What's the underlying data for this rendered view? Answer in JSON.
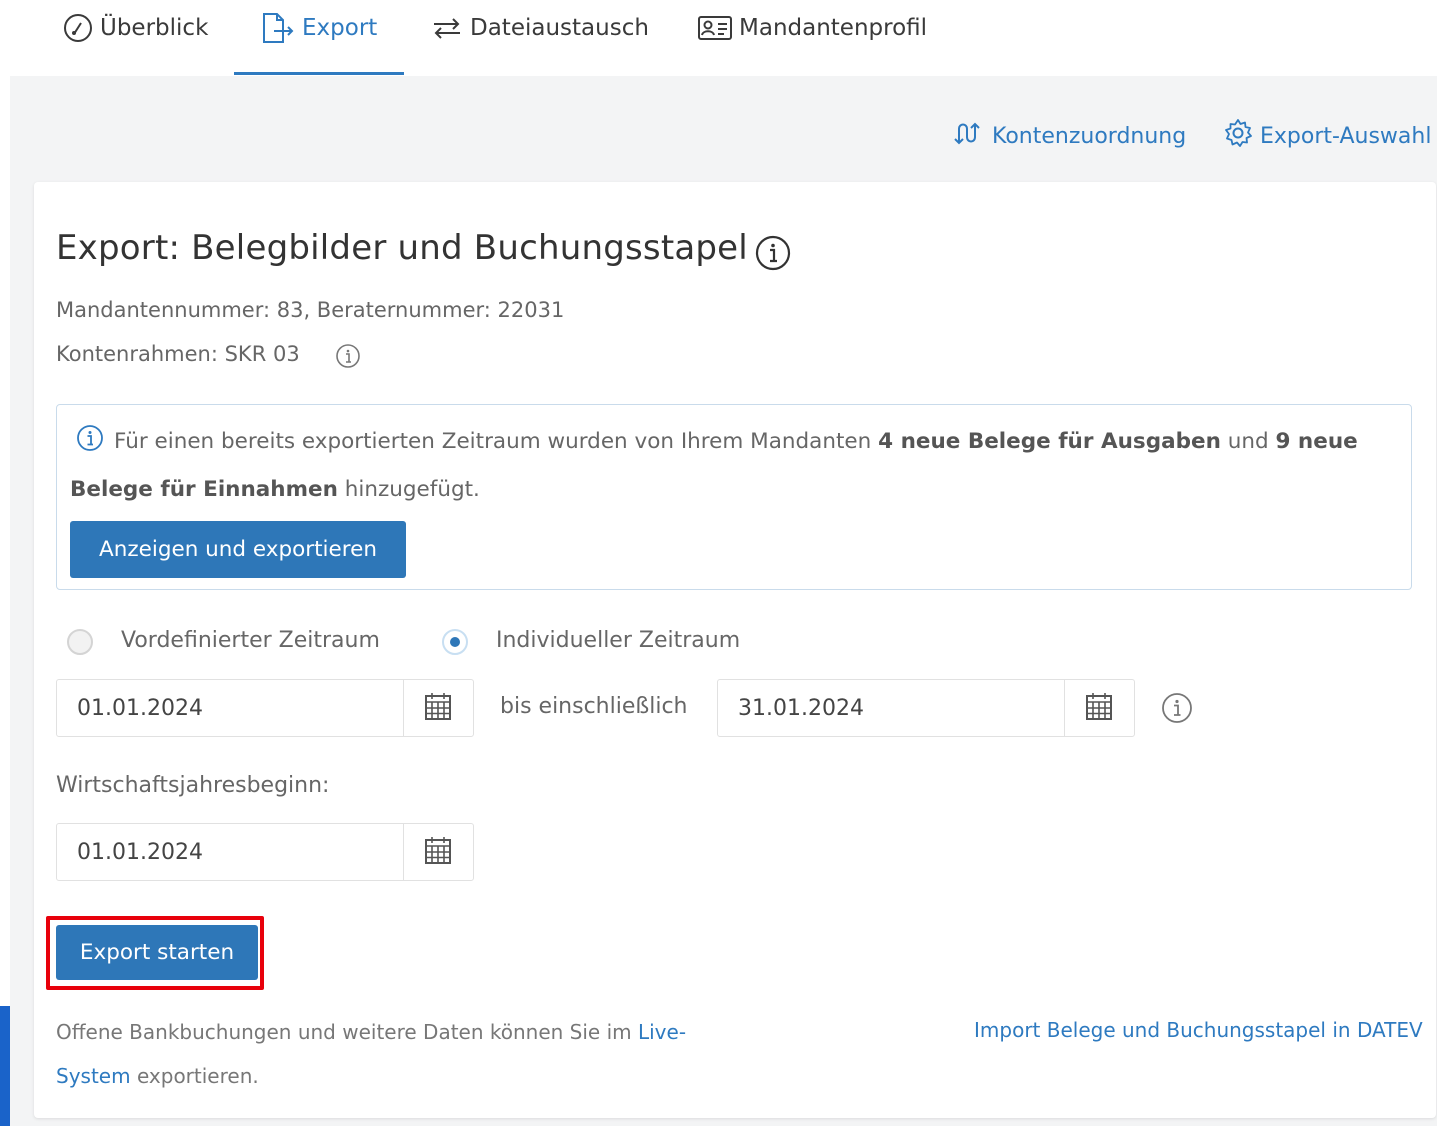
{
  "tabs": [
    {
      "label": "Überblick",
      "icon": "dial-icon",
      "active": false
    },
    {
      "label": "Export",
      "icon": "file-export-icon",
      "active": true
    },
    {
      "label": "Dateiaustausch",
      "icon": "swap-arrows-icon",
      "active": false
    },
    {
      "label": "Mandantenprofil",
      "icon": "id-card-icon",
      "active": false
    }
  ],
  "toolbar": {
    "kontenzuordnung": "Kontenzuordnung",
    "export_auswahl": "Export-Auswahl"
  },
  "card": {
    "title": "Export: Belegbilder und Buchungsstapel",
    "meta_numbers": "Mandantennummer: 83, Beraternummer: 22031",
    "meta_kontenrahmen": "Kontenrahmen: SKR 03"
  },
  "notice": {
    "text_1": "Für einen bereits exportierten Zeitraum wurden von Ihrem Mandanten",
    "bold_1": "4 neue Belege für Ausgaben",
    "text_2": "und",
    "bold_2": "9 neue Belege für Einnahmen",
    "text_3": "hinzugefügt.",
    "button": "Anzeigen und exportieren"
  },
  "period": {
    "option_predefined": "Vordefinierter Zeitraum",
    "option_individual": "Individueller Zeitraum",
    "selected": "individual",
    "from": "01.01.2024",
    "separator": "bis einschließlich",
    "to": "31.01.2024"
  },
  "fiscal_year": {
    "label": "Wirtschaftsjahresbeginn:",
    "value": "01.01.2024"
  },
  "actions": {
    "export_start": "Export starten"
  },
  "footer": {
    "text_before": "Offene Bankbuchungen und weitere Daten können Sie im",
    "link": "Live-System",
    "text_after": "exportieren.",
    "right_link": "Import Belege und Buchungsstapel in DATEV"
  },
  "colors": {
    "accent": "#2e7ac0",
    "primary_button": "#2e77b8",
    "highlight": "#e8000b",
    "background": "#f3f4f5"
  }
}
